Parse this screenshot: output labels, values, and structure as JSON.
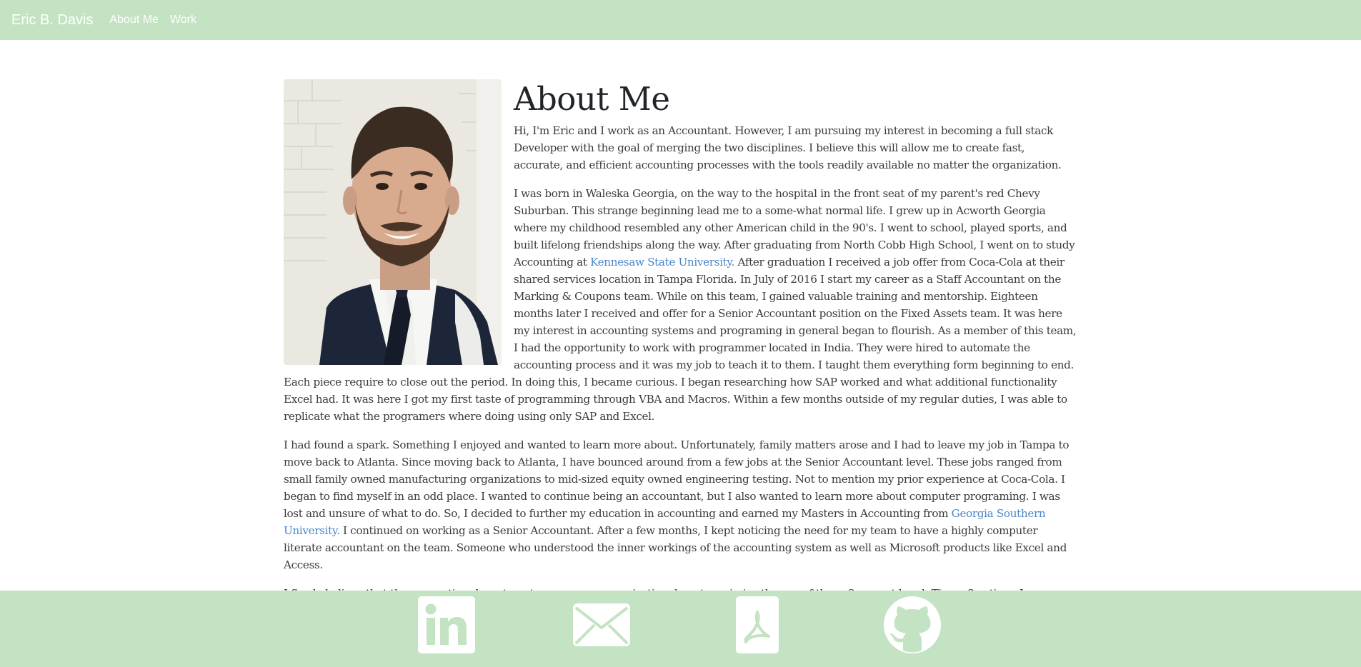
{
  "navbar": {
    "brand": "Eric B. Davis",
    "links": [
      "About Me",
      "Work"
    ]
  },
  "about": {
    "title": "About Me",
    "p1": "Hi, I'm Eric and I work as an Accountant. However, I am pursuing my interest in becoming a full stack Developer with the goal of merging the two disciplines. I believe this will allow me to create fast, accurate, and efficient accounting processes with the tools readily available no matter the organization.",
    "p2_before": "I was born in Waleska Georgia, on the way to the hospital in the front seat of my parent's red Chevy Suburban. This strange beginning lead me to a some-what normal life. I grew up in Acworth Georgia where my childhood resembled any other American child in the 90's. I went to school, played sports, and built lifelong friendships along the way. After graduating from North Cobb High School, I went on to study Accounting at ",
    "p2_link": "Kennesaw State University.",
    "p2_after": " After graduation I received a job offer from Coca-Cola at their shared services location in Tampa Florida. In July of 2016 I start my career as a Staff Accountant on the Marking & Coupons team. While on this team, I gained valuable training and mentorship. Eighteen months later I received and offer for a Senior Accountant position on the Fixed Assets team. It was here my interest in accounting systems and programing in general began to flourish. As a member of this team, I had the opportunity to work with programmer located in India. They were hired to automate the accounting process and it was my job to teach it to them. I taught them everything form beginning to end. Each piece require to close out the period. In doing this, I became curious. I began researching how SAP worked and what additional functionality Excel had. It was here I got my first taste of programming through VBA and Macros. Within a few months outside of my regular duties, I was able to replicate what the programers where doing using only SAP and Excel.",
    "p3_before": "I had found a spark. Something I enjoyed and wanted to learn more about. Unfortunately, family matters arose and I had to leave my job in Tampa to move back to Atlanta. Since moving back to Atlanta, I have bounced around from a few jobs at the Senior Accountant level. These jobs ranged from small family owned manufacturing organizations to mid-sized equity owned engineering testing. Not to mention my prior experience at Coca-Cola. I began to find myself in an odd place. I wanted to continue being an accountant, but I also wanted to learn more about computer programing. I was lost and unsure of what to do. So, I decided to further my education in accounting and earned my Masters in Accounting from ",
    "p3_link": "Georgia Southern University.",
    "p3_after": " I continued on working as a Senior Accountant. After a few months, I kept noticing the need for my team to have a highly computer literate accountant on the team. Someone who understood the inner workings of the accounting system as well as Microsoft products like Excel and Access.",
    "p4": "I firmly believe that the accounting departments across any organization do not maximize the use of the software at hand. Time after time, I see"
  },
  "footer": {
    "icons": [
      "linkedin-icon",
      "email-icon",
      "pdf-icon",
      "github-icon"
    ]
  },
  "colors": {
    "nav_bg": "#c3e3c3",
    "link": "#4a86c8",
    "text": "#3a3a3a"
  }
}
